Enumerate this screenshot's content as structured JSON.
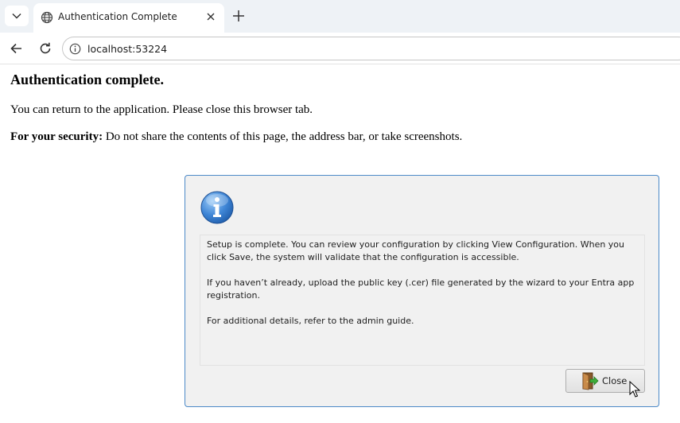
{
  "browser": {
    "tab_title": "Authentication Complete",
    "url": "localhost:53224"
  },
  "page": {
    "title": "Authentication complete.",
    "message": "You can return to the application. Please close this browser tab.",
    "security_label": "For your security:",
    "security_text": " Do not share the contents of this page, the address bar, or take screenshots."
  },
  "dialog": {
    "icon": "info-icon",
    "paragraph1": "Setup is complete. You can review your configuration by clicking View Configuration. When you click Save, the system will validate that the configuration is accessible.",
    "paragraph2": "If you haven’t already, upload the public key (.cer) file generated by the wizard to your Entra app registration.",
    "paragraph3": "For additional details, refer to the admin guide.",
    "close_label": "Close"
  },
  "colors": {
    "tabstrip": "#eef2f6",
    "dialog_border": "#4d8ac8",
    "dialog_bg": "#f1f1f1"
  }
}
